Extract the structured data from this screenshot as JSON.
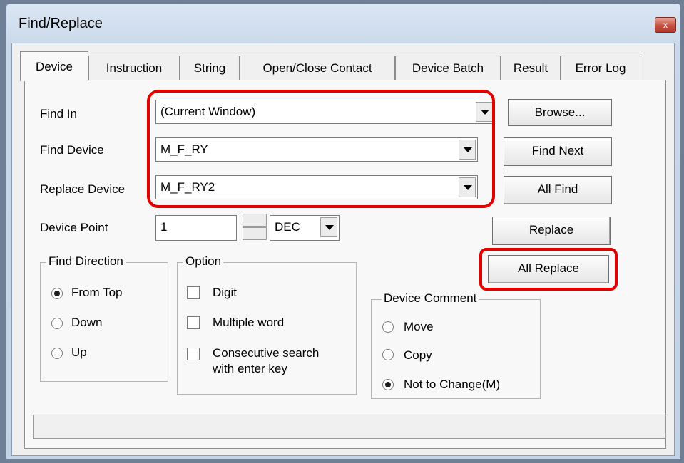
{
  "window": {
    "title": "Find/Replace",
    "close_glyph": "x"
  },
  "tabs": [
    "Device",
    "Instruction",
    "String",
    "Open/Close Contact",
    "Device Batch",
    "Result",
    "Error Log"
  ],
  "active_tab": "Device",
  "form": {
    "find_in_label": "Find In",
    "find_in_value": "(Current Window)",
    "find_device_label": "Find Device",
    "find_device_value": "M_F_RY",
    "replace_device_label": "Replace Device",
    "replace_device_value": "M_F_RY2",
    "device_point_label": "Device Point",
    "device_point_value": "1",
    "radix_value": "DEC"
  },
  "buttons": {
    "browse": "Browse...",
    "find_next": "Find Next",
    "all_find": "All Find",
    "replace": "Replace",
    "all_replace": "All Replace"
  },
  "find_direction": {
    "title": "Find Direction",
    "options": [
      "From Top",
      "Down",
      "Up"
    ],
    "selected": "From Top"
  },
  "option": {
    "title": "Option",
    "items": [
      "Digit",
      "Multiple word",
      "Consecutive search",
      "with enter key"
    ]
  },
  "device_comment": {
    "title": "Device Comment",
    "options": [
      "Move",
      "Copy",
      "Not to Change(M)"
    ],
    "selected": "Not to Change(M)"
  },
  "colors": {
    "highlight": "#e50000",
    "title_bar": "#c9d8ea"
  }
}
